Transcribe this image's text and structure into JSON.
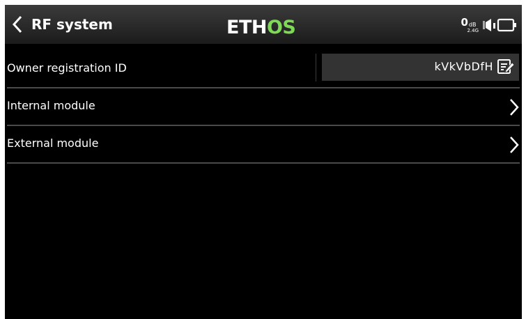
{
  "header": {
    "title": "RF system",
    "logo_text": "ETHOS",
    "logo_colors": {
      "main": "#ffffff",
      "accent": "#7ed957"
    },
    "rssi_value": "0",
    "rssi_unit": "dB",
    "rssi_band": "2.4G",
    "icons": [
      "back-chevron-icon",
      "speaker-icon",
      "battery-icon"
    ]
  },
  "rows": [
    {
      "label": "Owner registration ID",
      "value": "kVkVbDfH",
      "icon": "edit-icon"
    },
    {
      "label": "Internal module",
      "icon": "chevron-right-icon"
    },
    {
      "label": "External module",
      "icon": "chevron-right-icon"
    }
  ],
  "colors": {
    "background": "#000000",
    "header": "#2a2a2a",
    "field": "#333333",
    "divider": "#4a4a4a",
    "text": "#ffffff"
  }
}
